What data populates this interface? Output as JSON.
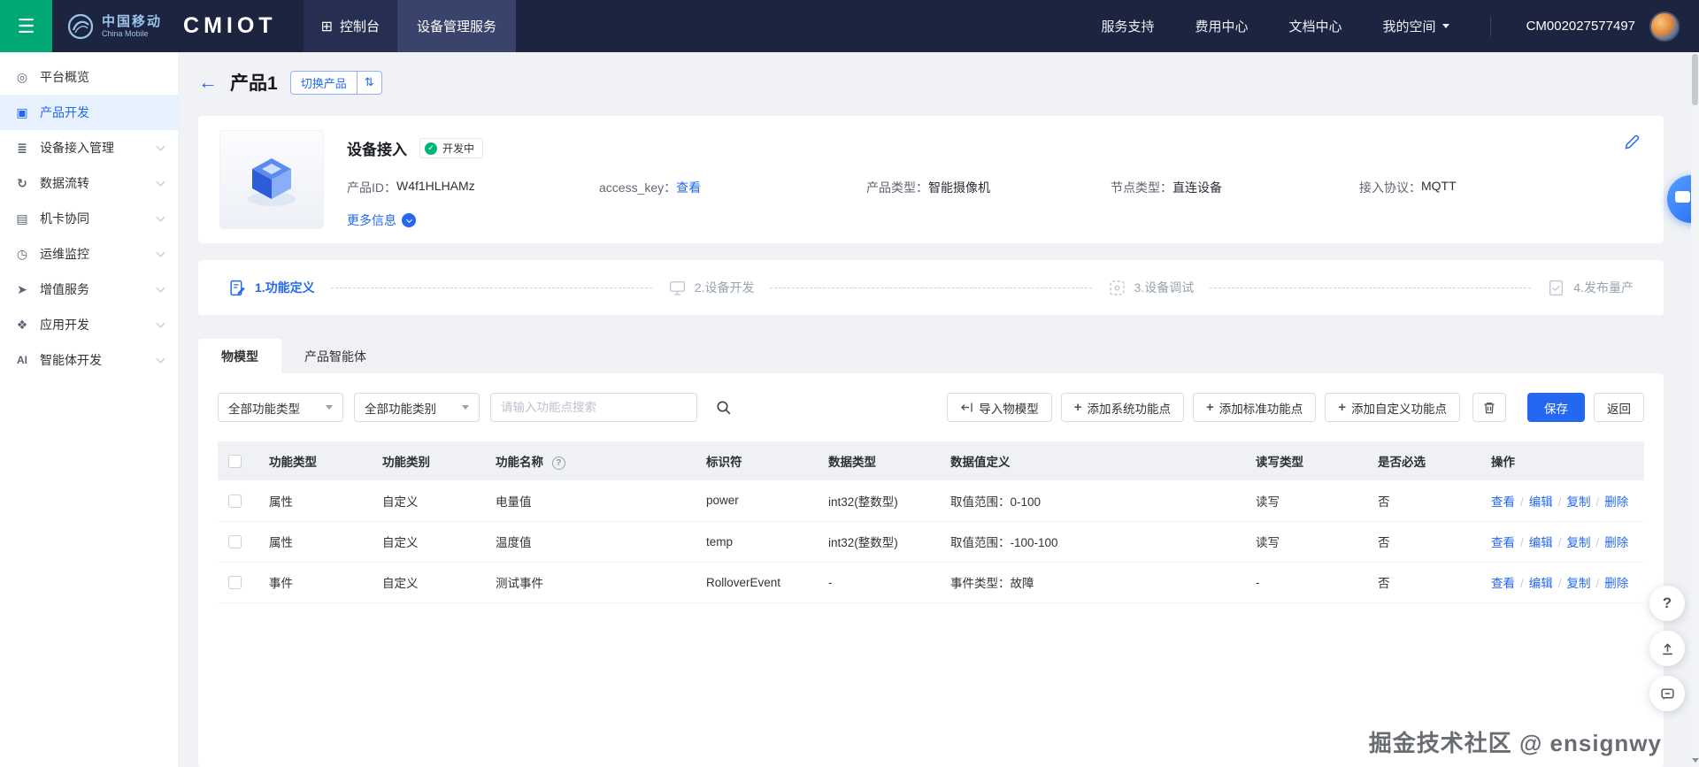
{
  "topbar": {
    "brand": {
      "cn": "中国移动",
      "en": "China Mobile",
      "product": "CMIOT"
    },
    "console": "控制台",
    "service": "设备管理服务",
    "links": [
      "服务支持",
      "费用中心",
      "文档中心",
      "我的空间"
    ],
    "account": "CM002027577497"
  },
  "sidebar": {
    "items": [
      {
        "icon": "◎",
        "label": "平台概览"
      },
      {
        "icon": "▣",
        "label": "产品开发"
      },
      {
        "icon": "≣",
        "label": "设备接入管理"
      },
      {
        "icon": "↻",
        "label": "数据流转"
      },
      {
        "icon": "▤",
        "label": "机卡协同"
      },
      {
        "icon": "◷",
        "label": "运维监控"
      },
      {
        "icon": "➤",
        "label": "增值服务"
      },
      {
        "icon": "❖",
        "label": "应用开发"
      },
      {
        "icon": "AI",
        "label": "智能体开发"
      }
    ]
  },
  "page": {
    "title": "产品1",
    "switch_label": "切换产品"
  },
  "product": {
    "name": "设备接入",
    "status": "开发中",
    "fields": [
      {
        "label": "产品ID：",
        "value": "W4f1HLHAMz"
      },
      {
        "label": "access_key：",
        "value": "查看"
      },
      {
        "label": "产品类型：",
        "value": "智能摄像机"
      },
      {
        "label": "节点类型：",
        "value": "直连设备"
      },
      {
        "label": "接入协议：",
        "value": "MQTT"
      }
    ],
    "more_label": "更多信息"
  },
  "steps": [
    {
      "label": "1.功能定义"
    },
    {
      "label": "2.设备开发"
    },
    {
      "label": "3.设备调试"
    },
    {
      "label": "4.发布量产"
    }
  ],
  "tabs": [
    {
      "label": "物模型"
    },
    {
      "label": "产品智能体"
    }
  ],
  "toolbar": {
    "type_filter": "全部功能类型",
    "category_filter": "全部功能类别",
    "search_placeholder": "请输入功能点搜索",
    "import_label": "导入物模型",
    "add_system_label": "添加系统功能点",
    "add_standard_label": "添加标准功能点",
    "add_custom_label": "添加自定义功能点",
    "save_label": "保存",
    "back_label": "返回"
  },
  "table": {
    "headers": [
      "功能类型",
      "功能类别",
      "功能名称",
      "标识符",
      "数据类型",
      "数据值定义",
      "读写类型",
      "是否必选",
      "操作"
    ],
    "rows": [
      {
        "type": "属性",
        "category": "自定义",
        "name": "电量值",
        "identifier": "power",
        "data_type": "int32(整数型)",
        "value_def": "取值范围：0-100",
        "rw": "读写",
        "required": "否"
      },
      {
        "type": "属性",
        "category": "自定义",
        "name": "温度值",
        "identifier": "temp",
        "data_type": "int32(整数型)",
        "value_def": "取值范围：-100-100",
        "rw": "读写",
        "required": "否"
      },
      {
        "type": "事件",
        "category": "自定义",
        "name": "测试事件",
        "identifier": "RolloverEvent",
        "data_type": "-",
        "value_def": "事件类型：故障",
        "rw": "-",
        "required": "否"
      }
    ],
    "actions": [
      "查看",
      "编辑",
      "复制",
      "删除"
    ]
  },
  "icons": {
    "menu": "☰",
    "back": "←",
    "console": "⊞",
    "swap": "⇅",
    "check": "✓",
    "plus": "+",
    "question": "?",
    "sep": "/"
  },
  "colors": {
    "accent": "#2468f2",
    "navbar_bg": "#1c2440",
    "menu_green": "#00a875",
    "status_green": "#00b578"
  },
  "watermark": "掘金技术社区 @ ensignwy"
}
